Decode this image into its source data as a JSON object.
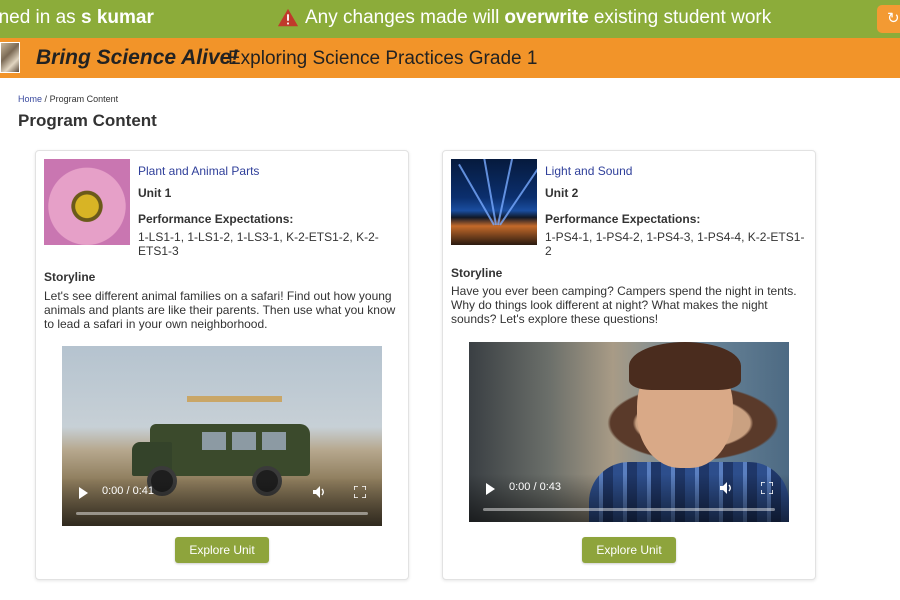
{
  "topbar": {
    "signed_in_prefix": "gned in as",
    "username": "s kumar",
    "warning_before": "Any changes made will",
    "warning_bold": "overwrite",
    "warning_after": "existing student work",
    "corner_button_glyph": "↻",
    "bg_color": "#8cac3a"
  },
  "brand": {
    "logo_text": "Bring Science Alive!",
    "subtitle": "Exploring Science Practices Grade 1",
    "bg_color": "#f29429"
  },
  "breadcrumb": {
    "home": "Home",
    "separator": "/",
    "current": "Program Content"
  },
  "page_title": "Program Content",
  "cards": [
    {
      "title": "Plant and Animal Parts",
      "unit": "Unit 1",
      "pe_label": "Performance Expectations:",
      "pe_value": "1-LS1-1, 1-LS1-2, 1-LS3-1, K-2-ETS1-2, K-2-ETS1-3",
      "storyline_label": "Storyline",
      "storyline": "Let's see different animal families on a safari! Find out how young animals and plants are like their parents. Then use what you know to lead a safari in your own neighborhood.",
      "video_time": "0:00 / 0:41",
      "button": "Explore Unit",
      "thumb_icon": "bee-flower-image"
    },
    {
      "title": "Light and Sound",
      "unit": "Unit 2",
      "pe_label": "Performance Expectations:",
      "pe_value": "1-PS4-1, 1-PS4-2, 1-PS4-3, 1-PS4-4, K-2-ETS1-2",
      "storyline_label": "Storyline",
      "storyline": "Have you ever been camping? Campers spend the night in tents. Why do things look different at night? What makes the night sounds? Let's explore these questions!",
      "video_time": "0:00 / 0:43",
      "button": "Explore Unit",
      "thumb_icon": "city-lights-image"
    }
  ]
}
